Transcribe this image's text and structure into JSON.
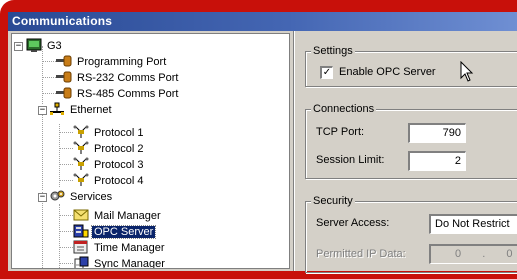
{
  "window": {
    "title": "Communications"
  },
  "tree": {
    "root": "G3",
    "items": [
      {
        "label": "Programming Port",
        "icon": "port-icon"
      },
      {
        "label": "RS-232 Comms Port",
        "icon": "port-icon"
      },
      {
        "label": "RS-485 Comms Port",
        "icon": "port-icon"
      },
      {
        "label": "Ethernet",
        "icon": "ethernet-icon"
      },
      {
        "label": "Protocol 1",
        "icon": "protocol-icon"
      },
      {
        "label": "Protocol 2",
        "icon": "protocol-icon"
      },
      {
        "label": "Protocol 3",
        "icon": "protocol-icon"
      },
      {
        "label": "Protocol 4",
        "icon": "protocol-icon"
      },
      {
        "label": "Services",
        "icon": "services-icon"
      },
      {
        "label": "Mail Manager",
        "icon": "mail-icon"
      },
      {
        "label": "OPC Server",
        "icon": "opc-server-icon",
        "selected": true
      },
      {
        "label": "Time Manager",
        "icon": "time-icon"
      },
      {
        "label": "Sync Manager",
        "icon": "sync-icon"
      }
    ]
  },
  "settings": {
    "title": "Settings",
    "enable_opc": {
      "label": "Enable OPC Server",
      "checked": true
    }
  },
  "connections": {
    "title": "Connections",
    "tcp_port_label": "TCP Port:",
    "tcp_port_value": "790",
    "session_limit_label": "Session Limit:",
    "session_limit_value": "2"
  },
  "security": {
    "title": "Security",
    "server_access_label": "Server Access:",
    "server_access_value": "Do Not Restrict",
    "permitted_ip_label": "Permitted IP Data:",
    "permitted_ip_values": [
      "0",
      "0"
    ]
  },
  "colors": {
    "frame": "#c8100a",
    "titlebar_start": "#2a4a94",
    "titlebar_end": "#6f8fd3",
    "selection": "#0a246a",
    "face": "#d4d0c8"
  }
}
